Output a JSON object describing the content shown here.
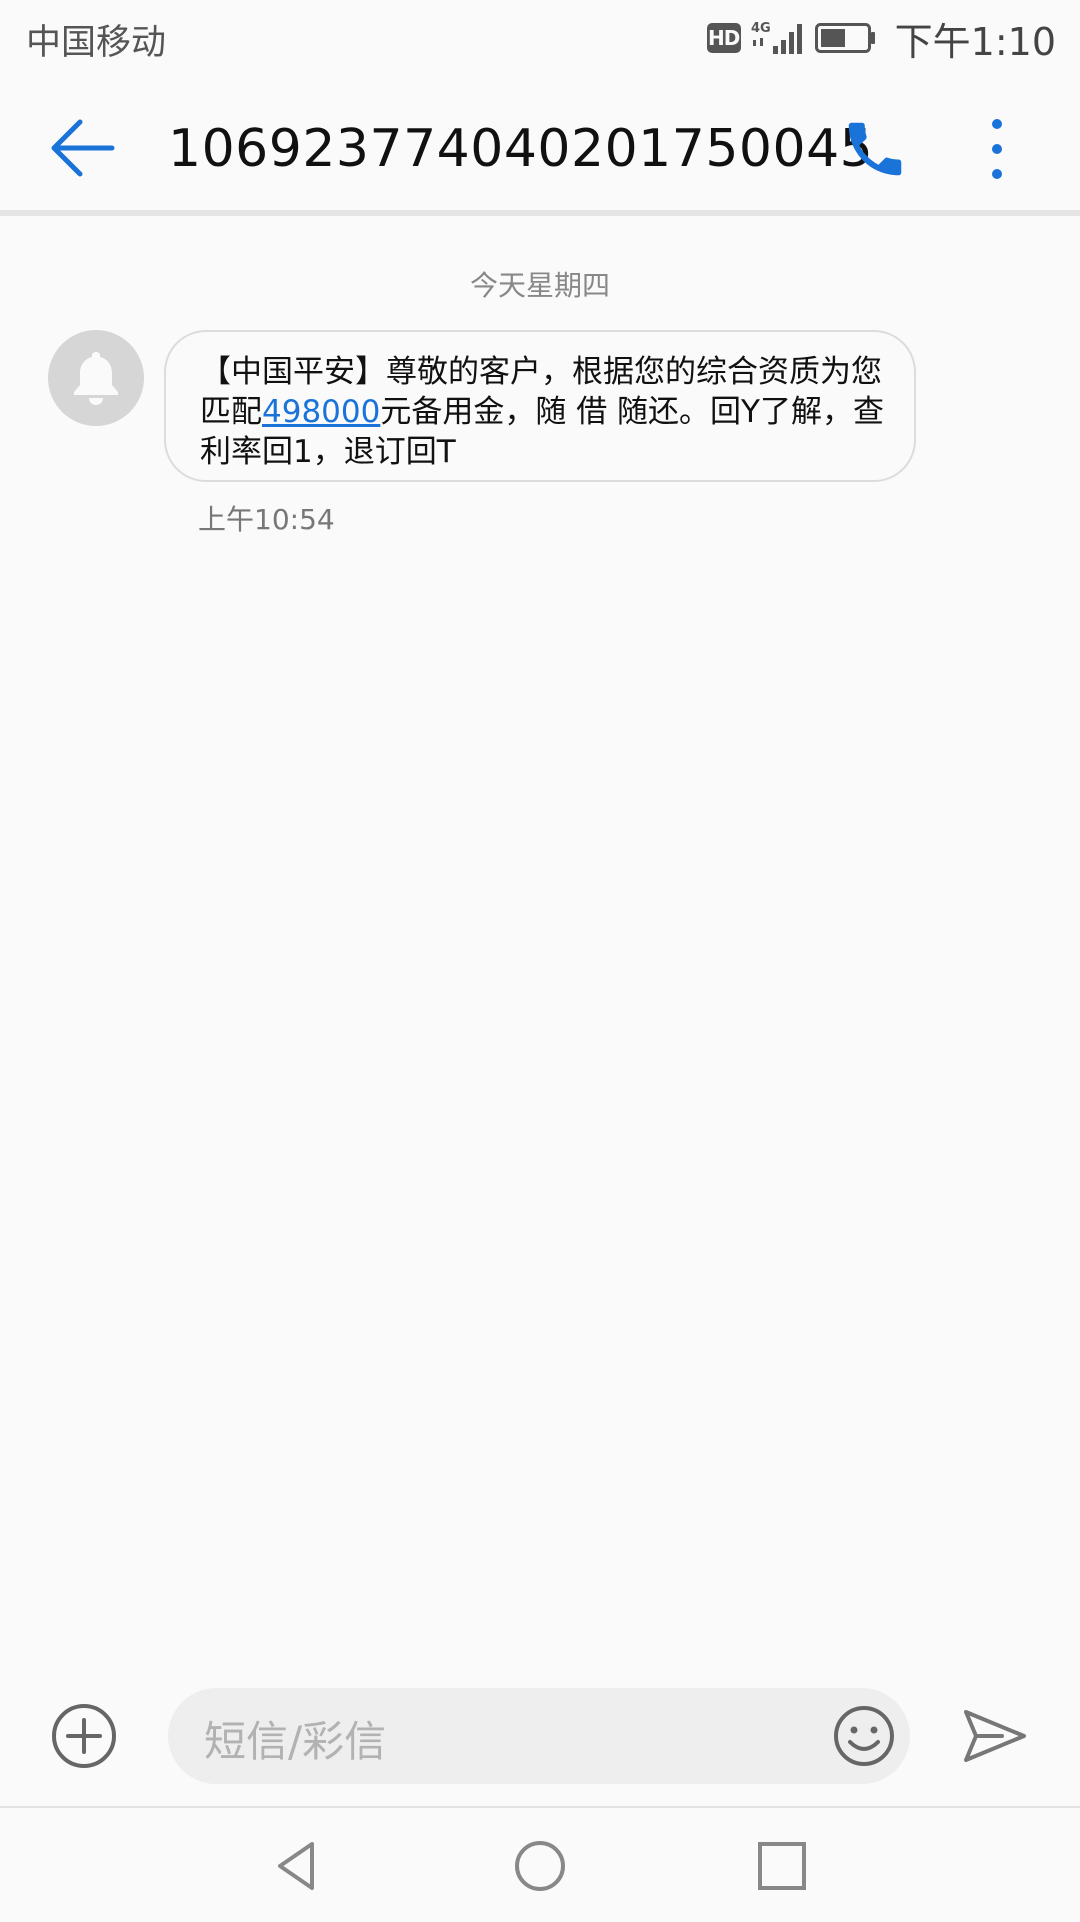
{
  "status_bar": {
    "carrier": "中国移动",
    "hd_badge": "HD",
    "network": "4G",
    "clock": "下午1:10"
  },
  "toolbar": {
    "title": "106923774040201750045"
  },
  "conversation": {
    "date_divider": "今天星期四",
    "messages": [
      {
        "text_before": "【中国平安】尊敬的客户，根据您的综合资质为您匹配",
        "amount": "498000",
        "text_after": "元备用金，随 借 随还。回Y了解，查利率回1，退订回T",
        "time": "上午10:54"
      }
    ]
  },
  "composer": {
    "placeholder": "短信/彩信"
  },
  "colors": {
    "accent": "#1a73d9",
    "background": "#fafafa",
    "bubble_border": "#dcdcdc"
  }
}
